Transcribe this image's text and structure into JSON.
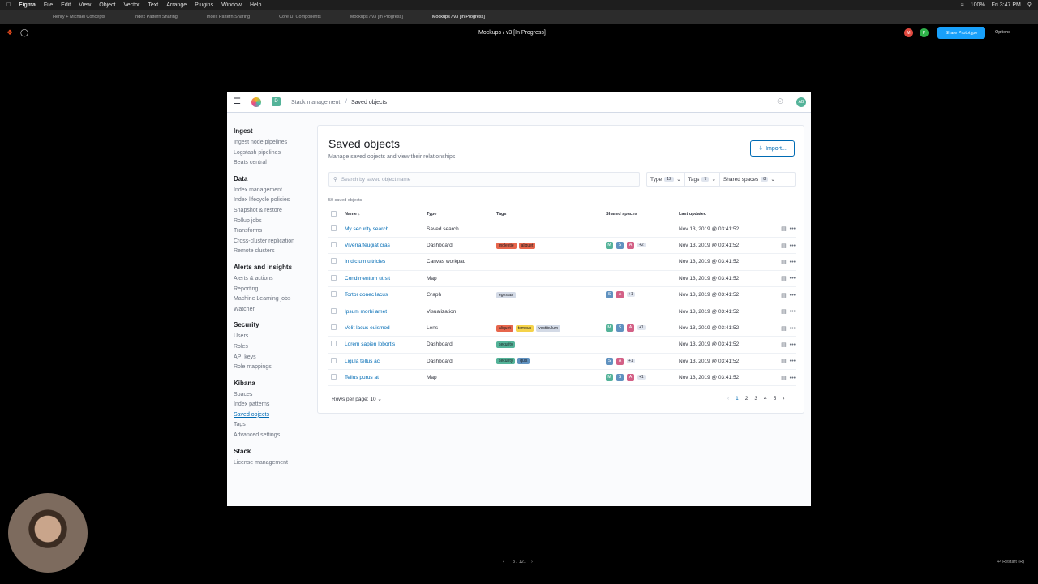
{
  "mac": {
    "app": "Figma",
    "menus": [
      "File",
      "Edit",
      "View",
      "Object",
      "Vector",
      "Text",
      "Arrange",
      "Plugins",
      "Window",
      "Help"
    ],
    "status": "100%",
    "time": "Fri 3:47 PM"
  },
  "figma": {
    "tabs": [
      "Henry + Michael Concepts",
      "Index Pattern Sharing",
      "Index Pattern Sharing",
      "Core UI Components",
      "Mockups / v3 [In Progress]",
      "Mockups / v3 [In Progress]"
    ],
    "title": "Mockups / v3 [In Progress]",
    "share": "Share Prototype",
    "options": "Options",
    "avatars": [
      "M",
      "P"
    ],
    "page_counter": "3 / 121",
    "restart": "Restart (R)"
  },
  "kibana": {
    "space": "D",
    "avatar": "AB",
    "breadcrumbs": [
      "Stack management",
      "Saved objects"
    ],
    "nav": [
      {
        "title": "Ingest",
        "items": [
          "Ingest node pipelines",
          "Logstash pipelines",
          "Beats central"
        ]
      },
      {
        "title": "Data",
        "items": [
          "Index management",
          "Index lifecycle policies",
          "Snapshot & restore",
          "Rollup jobs",
          "Transforms",
          "Cross-cluster replication",
          "Remote clusters"
        ]
      },
      {
        "title": "Alerts and insights",
        "items": [
          "Alerts & actions",
          "Reporting",
          "Machine Learning jobs",
          "Watcher"
        ]
      },
      {
        "title": "Security",
        "items": [
          "Users",
          "Roles",
          "API keys",
          "Role mappings"
        ]
      },
      {
        "title": "Kibana",
        "items": [
          "Spaces",
          "Index patterns",
          "Saved objects",
          "Tags",
          "Advanced settings"
        ]
      },
      {
        "title": "Stack",
        "items": [
          "License management"
        ]
      }
    ],
    "page_title": "Saved objects",
    "page_subtitle": "Manage saved objects and view their relationships",
    "import_label": "Import...",
    "search_placeholder": "Search by saved object name",
    "filters": [
      {
        "label": "Type",
        "count": "12"
      },
      {
        "label": "Tags",
        "count": "7"
      },
      {
        "label": "Shared spaces",
        "count": "8"
      }
    ],
    "count_label": "50 saved objects",
    "columns": [
      "Name",
      "Type",
      "Tags",
      "Shared spaces",
      "Last updated"
    ],
    "rows": [
      {
        "name": "My security search",
        "type": "Saved search",
        "tags": [],
        "spaces": [],
        "more": "",
        "updated": "Nov 13, 2019 @ 03:41:52"
      },
      {
        "name": "Viverra feugiat cras",
        "type": "Dashboard",
        "tags": [
          {
            "t": "molestie",
            "c": "#e7664c"
          },
          {
            "t": "aliquet",
            "c": "#e7664c"
          }
        ],
        "spaces": [
          "M",
          "S",
          "A"
        ],
        "more": "+2",
        "updated": "Nov 13, 2019 @ 03:41:52"
      },
      {
        "name": "In dictum ultricies",
        "type": "Canvas workpad",
        "tags": [],
        "spaces": [],
        "more": "",
        "updated": "Nov 13, 2019 @ 03:41:52"
      },
      {
        "name": "Condimentum ut sit",
        "type": "Map",
        "tags": [],
        "spaces": [],
        "more": "",
        "updated": "Nov 13, 2019 @ 03:41:52"
      },
      {
        "name": "Tortor donec lacus",
        "type": "Graph",
        "tags": [
          {
            "t": "egestas",
            "c": "#d3dae6"
          }
        ],
        "spaces": [
          "S",
          "A"
        ],
        "more": "+1",
        "updated": "Nov 13, 2019 @ 03:41:52"
      },
      {
        "name": "Ipsum morbi amet",
        "type": "Visualization",
        "tags": [],
        "spaces": [],
        "more": "",
        "updated": "Nov 13, 2019 @ 03:41:52"
      },
      {
        "name": "Velit lacus euismod",
        "type": "Lens",
        "tags": [
          {
            "t": "aliquet",
            "c": "#e7664c"
          },
          {
            "t": "tempus",
            "c": "#f5d34a"
          },
          {
            "t": "vestibulum",
            "c": "#d3dae6"
          }
        ],
        "spaces": [
          "M",
          "S",
          "A"
        ],
        "more": "+1",
        "updated": "Nov 13, 2019 @ 03:41:52"
      },
      {
        "name": "Lorem sapien lobortis",
        "type": "Dashboard",
        "tags": [
          {
            "t": "security",
            "c": "#54b399"
          }
        ],
        "spaces": [],
        "more": "",
        "updated": "Nov 13, 2019 @ 03:41:52"
      },
      {
        "name": "Ligula tellus ac",
        "type": "Dashboard",
        "tags": [
          {
            "t": "security",
            "c": "#54b399"
          },
          {
            "t": "quis",
            "c": "#6092c0"
          }
        ],
        "spaces": [
          "S",
          "A"
        ],
        "more": "+1",
        "updated": "Nov 13, 2019 @ 03:41:52"
      },
      {
        "name": "Tellus purus at",
        "type": "Map",
        "tags": [],
        "spaces": [
          "M",
          "S",
          "A"
        ],
        "more": "+1",
        "updated": "Nov 13, 2019 @ 03:41:52"
      }
    ],
    "rows_per_page": "Rows per page: 10",
    "pages": [
      "1",
      "2",
      "3",
      "4",
      "5"
    ],
    "space_colors": {
      "M": "#54b399",
      "S": "#6092c0",
      "A": "#d36086"
    }
  }
}
